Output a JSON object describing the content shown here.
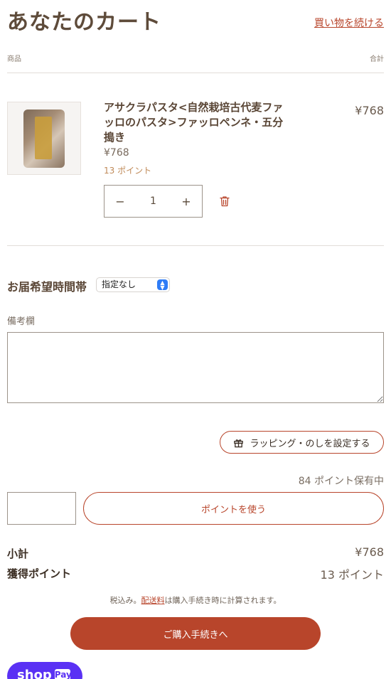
{
  "header": {
    "title": "あなたのカート",
    "continue_shopping": "買い物を続ける"
  },
  "columns": {
    "product": "商品",
    "total": "合計"
  },
  "item": {
    "name": "アサクラパスタ<自然栽培古代麦ファッロのパスタ>ファッロペンネ・五分搗き",
    "total": "¥768",
    "unit_price": "¥768",
    "points": "13 ポイント",
    "quantity": "1",
    "minus": "−",
    "plus": "+"
  },
  "delivery": {
    "label": "お届希望時間帯",
    "selected": "指定なし"
  },
  "notes": {
    "label": "備考欄",
    "value": ""
  },
  "wrapping": {
    "label": "ラッピング・のしを設定する"
  },
  "points": {
    "held": "84 ポイント保有中",
    "input_value": "",
    "use_label": "ポイントを使う"
  },
  "summary": {
    "subtotal_label": "小計",
    "subtotal_value": "¥768",
    "earned_label": "獲得ポイント",
    "earned_value": "13 ポイント"
  },
  "tax_note": {
    "prefix": "税込み。",
    "shipping_link": "配送料",
    "suffix": "は購入手続き時に計算されます。"
  },
  "checkout": {
    "label": "ご購入手続きへ"
  },
  "shop_pay": {
    "label": "shop",
    "badge": "Pay"
  },
  "colors": {
    "accent": "#b8452b",
    "text": "#5a4636",
    "shop_pay": "#5a31f4"
  }
}
